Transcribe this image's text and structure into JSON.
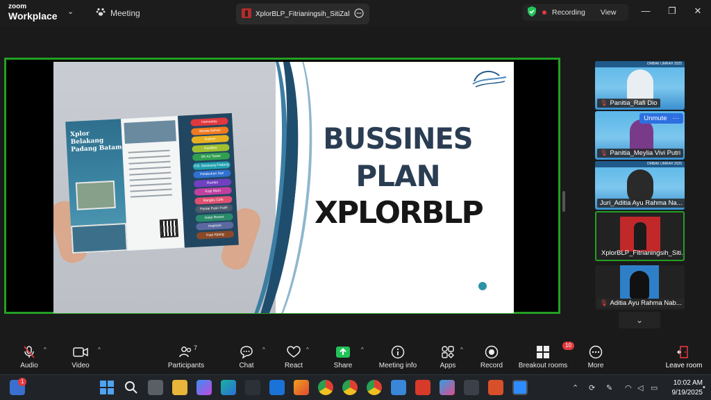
{
  "topbar": {
    "logo_line1": "zoom",
    "logo_line2": "Workplace",
    "meeting_label": "Meeting",
    "tab_title": "XplorBLP_Fitrianingsih_SitiZalleha's",
    "recording_label": "Recording",
    "view_label": "View"
  },
  "slide": {
    "line1": "BUSSINES",
    "line2": "PLAN",
    "line3": "XPLORBLP",
    "brochure_title": "Xplor Belakang Padang Batam",
    "brochure_tags": [
      "Homestay",
      "Wisata Bahari",
      "Kuliner",
      "Fasilitas",
      "Bh Air Tawar",
      "P.B. Belakang Padang",
      "Pelabuhan Sari",
      "Rumbo",
      "Kopi Mam",
      "Bangku Cafe",
      "Pantai Pasir Putih",
      "Hotel Resort",
      "Inspirasi",
      "Kopi Abang"
    ]
  },
  "participants": [
    {
      "name": "Panitia_Rafi Dio",
      "banner": "OMBAK UMRAH 2025",
      "muted": true
    },
    {
      "name": "Panitia_Meylia Vivi Putri",
      "banner": "OMBAK UMRAH 2025",
      "muted": true,
      "unmute_label": "Unmute",
      "more": "···"
    },
    {
      "name": "Juri_Aditia Ayu Rahma Na...",
      "banner": "OMBAK UMRAH 2025",
      "muted": false
    },
    {
      "name": "XplorBLP_Fitrianingsih_Siti...",
      "muted": false,
      "active": true
    },
    {
      "name": "Aditia Ayu Rahma Nab...",
      "muted": true
    }
  ],
  "toolbar": {
    "audio": "Audio",
    "video": "Video",
    "participants": "Participants",
    "participants_count": "7",
    "chat": "Chat",
    "react": "React",
    "share": "Share",
    "meeting_info": "Meeting info",
    "apps": "Apps",
    "record": "Record",
    "breakout": "Breakout rooms",
    "breakout_badge": "10",
    "more": "More",
    "leave": "Leave room"
  },
  "taskbar": {
    "time": "10:02 AM",
    "date": "9/19/2025",
    "notif_badge": "1"
  },
  "colors": {
    "active_speaker": "#23a023",
    "record_red": "#e0383e",
    "share_green": "#23c25a",
    "slide_navy": "#2a3d52"
  }
}
